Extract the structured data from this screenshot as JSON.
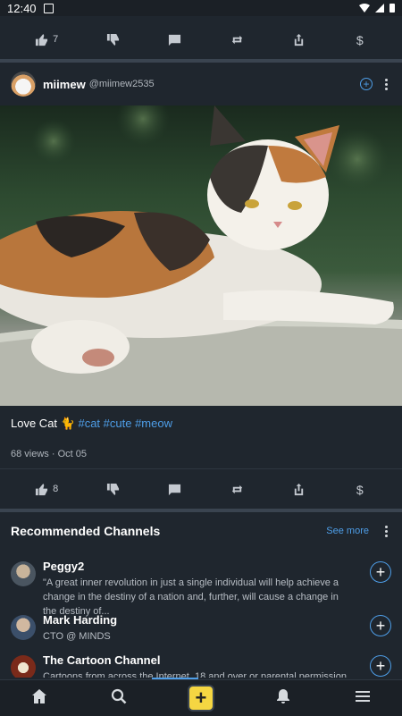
{
  "status_bar": {
    "time": "12:40"
  },
  "top_actions": {
    "likes": "7"
  },
  "post": {
    "username": "miimew",
    "handle": "@miimew2535",
    "caption_text": "Love Cat 🐈",
    "hashtags": "#cat #cute #meow",
    "meta": "68 views · Oct 05",
    "likes": "8"
  },
  "recommended": {
    "title": "Recommended Channels",
    "see_more": "See more",
    "channels": [
      {
        "name": "Peggy2",
        "desc": "\"A great inner revolution in just a single individual will help achieve a change in the destiny of a nation and, further, will cause a change in the destiny of..."
      },
      {
        "name": "Mark Harding",
        "desc": "CTO @ MINDS"
      },
      {
        "name": "The Cartoon Channel",
        "desc": "Cartoons from across the Internet. 18 and over or parental permission"
      }
    ]
  },
  "colors": {
    "accent": "#4e9ee8",
    "background": "#1f262e",
    "compose": "#f5d642"
  }
}
